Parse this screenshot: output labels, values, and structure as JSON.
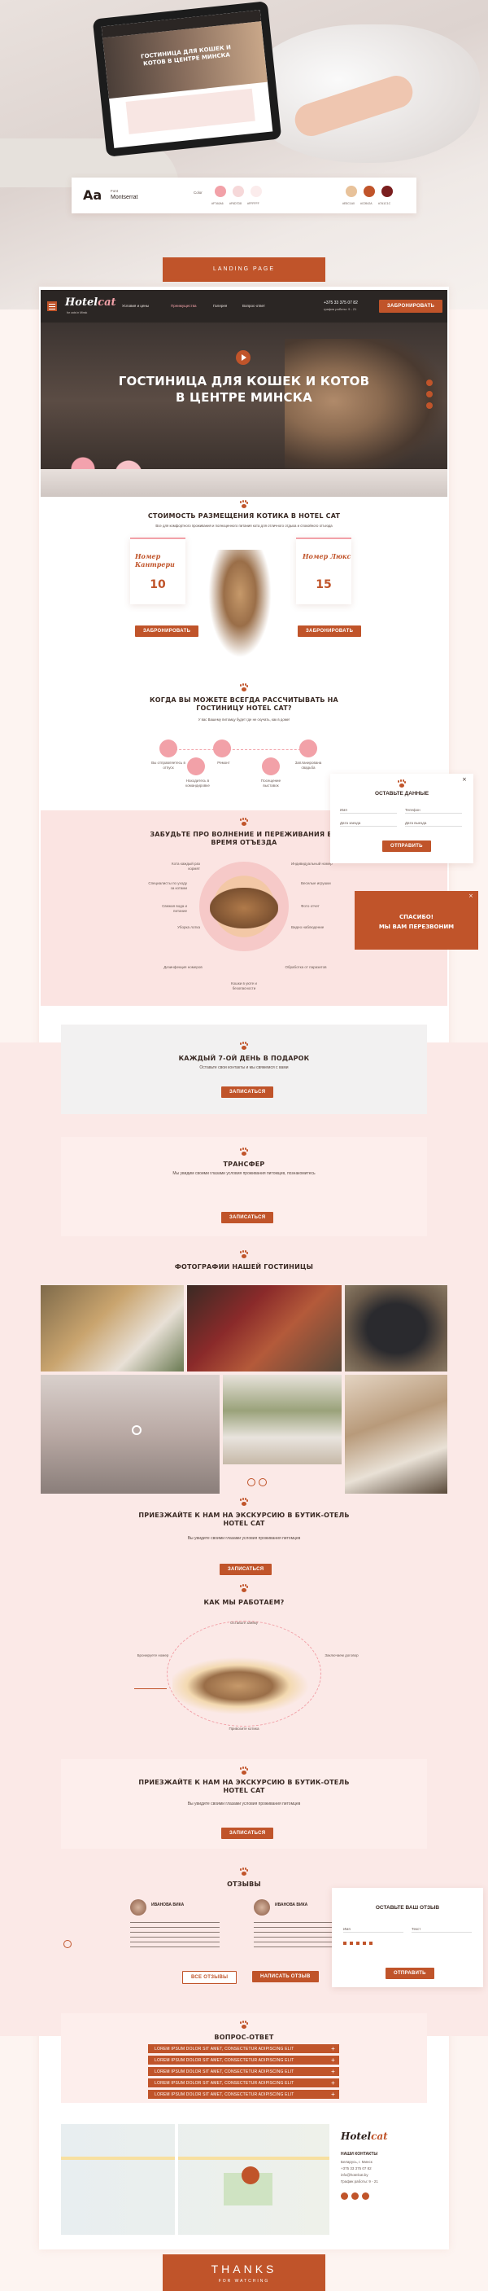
{
  "presentation": {
    "project_label": "LANDING PAGE",
    "thanks": "THANKS",
    "for_watching": "FOR WATCHING"
  },
  "style": {
    "aa": "Aa",
    "font_label": "Font",
    "font_name": "Montserrat",
    "color_label": "Color",
    "swatches": [
      "#f2a1a8",
      "#f6d8d9",
      "#fbecec",
      "#e8c29a",
      "#c0542a",
      "#7a1e1e"
    ],
    "swatch_labels": [
      "#F7A0A6",
      "#F6D7D8",
      "#FFFFFF",
      "#E5C1A0",
      "#C0542A",
      "#7A1C1C"
    ],
    "accent": "#c0542a",
    "pink": "#f2a1a8"
  },
  "header": {
    "logo": "Hotel",
    "logo2": "cat",
    "logo_sub": "for cats in Minsk",
    "nav": [
      "Условия и цены",
      "Преимущества",
      "Галерея",
      "Вопрос-ответ"
    ],
    "phone": "+375 33 375 07 82",
    "hours": "график работы: 9 - 21",
    "cta": "ЗАБРОНИРОВАТЬ"
  },
  "hero": {
    "title": "ГОСТИНИЦА ДЛЯ КОШЕК И КОТОВ В ЦЕНТРЕ МИНСКА"
  },
  "pricing": {
    "title": "СТОИМОСТЬ РАЗМЕЩЕНИЯ КОТИКА В HOTEL CAT",
    "subtitle": "Все для комфортного проживания и полноценного питания кота для отличного отдыха и спокойного отъезда",
    "left": {
      "name": "Номер Кантрери",
      "price": "10",
      "cta": "ЗАБРОНИРОВАТЬ"
    },
    "right": {
      "name": "Номер Люкс",
      "price": "15",
      "cta": "ЗАБРОНИРОВАТЬ"
    }
  },
  "when": {
    "title": "КОГДА ВЫ МОЖЕТЕ ВСЕГДА РАССЧИТЫВАТЬ НА ГОСТИНИЦУ HOTEL CAT?",
    "subtitle": "У вас Вашему питомцу будет где не скучать, как в доме!",
    "items": [
      "Вы отправляетесь в отпуск",
      "Находитесь в командировке",
      "Ремонт",
      "Посещение выставок",
      "Запланирована свадьба"
    ]
  },
  "forget": {
    "title": "ЗАБУДЬТЕ ПРО ВОЛНЕНИЕ И ПЕРЕЖИВАНИЯ ВО ВРЕМЯ ОТЪЕЗДА",
    "left": [
      "Кота каждый раз кормят",
      "Специалисты по уходу за котами",
      "Свежая вода и питание",
      "Уборка лотка"
    ],
    "right": [
      "Индивидуальный номер",
      "Веселые игрушки",
      "Фото отчет",
      "Видео наблюдение"
    ],
    "bottom": [
      "Дезинфекция номеров",
      "Кошки в уюте и безопасности",
      "Обработка от паразитов"
    ]
  },
  "form": {
    "title": "ОСТАВЬТЕ ДАННЫЕ",
    "fields": [
      "Имя",
      "Телефон",
      "Дата заезда",
      "Дата выезда"
    ],
    "cta": "ОТПРАВИТЬ"
  },
  "thanks_popup": {
    "line1": "СПАСИБО!",
    "line2": "МЫ ВАМ ПЕРЕЗВОНИМ"
  },
  "gift": {
    "title": "КАЖДЫЙ 7-ОЙ ДЕНЬ В ПОДАРОК",
    "text": "Оставьте свои контакты и мы свяжемся с вами",
    "cta": "ЗАПИСАТЬСЯ"
  },
  "transfer": {
    "title": "ТРАНСФЕР",
    "text": "Мы увидим своими глазами условия проживания питомцев, познакомитесь",
    "cta": "ЗАПИСАТЬСЯ"
  },
  "gallery": {
    "title": "ФОТОГРАФИИ НАШЕЙ ГОСТИНИЦЫ"
  },
  "excursion1": {
    "title": "ПРИЕЗЖАЙТЕ К НАМ НА ЭКСКУРСИЮ В БУТИК-ОТЕЛЬ HOTEL CAT",
    "text": "Вы увидите своими глазами условия проживания питомцев",
    "cta": "ЗАПИСАТЬСЯ"
  },
  "how": {
    "title": "КАК МЫ РАБОТАЕМ?",
    "steps": [
      "Оставьте заявку",
      "Бронируете номер",
      "Заключаем договор",
      "Привозите котика"
    ]
  },
  "excursion2": {
    "title": "ПРИЕЗЖАЙТЕ К НАМ НА ЭКСКУРСИЮ В БУТИК-ОТЕЛЬ HOTEL CAT",
    "text": "Вы увидите своими глазами условия проживания питомцев",
    "cta": "ЗАПИСАТЬСЯ"
  },
  "reviews": {
    "title": "ОТЗЫВЫ",
    "names": [
      "ИВАНОВА ВИКА",
      "ИВАНОВА ВИКА"
    ],
    "all": "ВСЕ ОТЗЫВЫ",
    "write": "НАПИСАТЬ ОТЗЫВ"
  },
  "review_form": {
    "title": "ОСТАВЬТЕ ВАШ ОТЗЫВ",
    "fields": [
      "Имя",
      "Текст"
    ],
    "cta": "ОТПРАВИТЬ"
  },
  "faq": {
    "title": "ВОПРОС-ОТВЕТ",
    "items": [
      "LOREM IPSUM DOLOR SIT AMET, CONSECTETUR ADIPISCING ELIT",
      "LOREM IPSUM DOLOR SIT AMET, CONSECTETUR ADIPISCING ELIT",
      "LOREM IPSUM DOLOR SIT AMET, CONSECTETUR ADIPISCING ELIT",
      "LOREM IPSUM DOLOR SIT AMET, CONSECTETUR ADIPISCING ELIT",
      "LOREM IPSUM DOLOR SIT AMET, CONSECTETUR ADIPISCING ELIT"
    ]
  },
  "contacts": {
    "logo": "Hotel",
    "logo2": "cat",
    "title": "НАШИ КОНТАКТЫ",
    "address": "Беларусь, г. Минск",
    "phone": "+375 33 375 07 82",
    "email": "info@hotelcat.by",
    "hours": "График работы: 9 - 21"
  }
}
